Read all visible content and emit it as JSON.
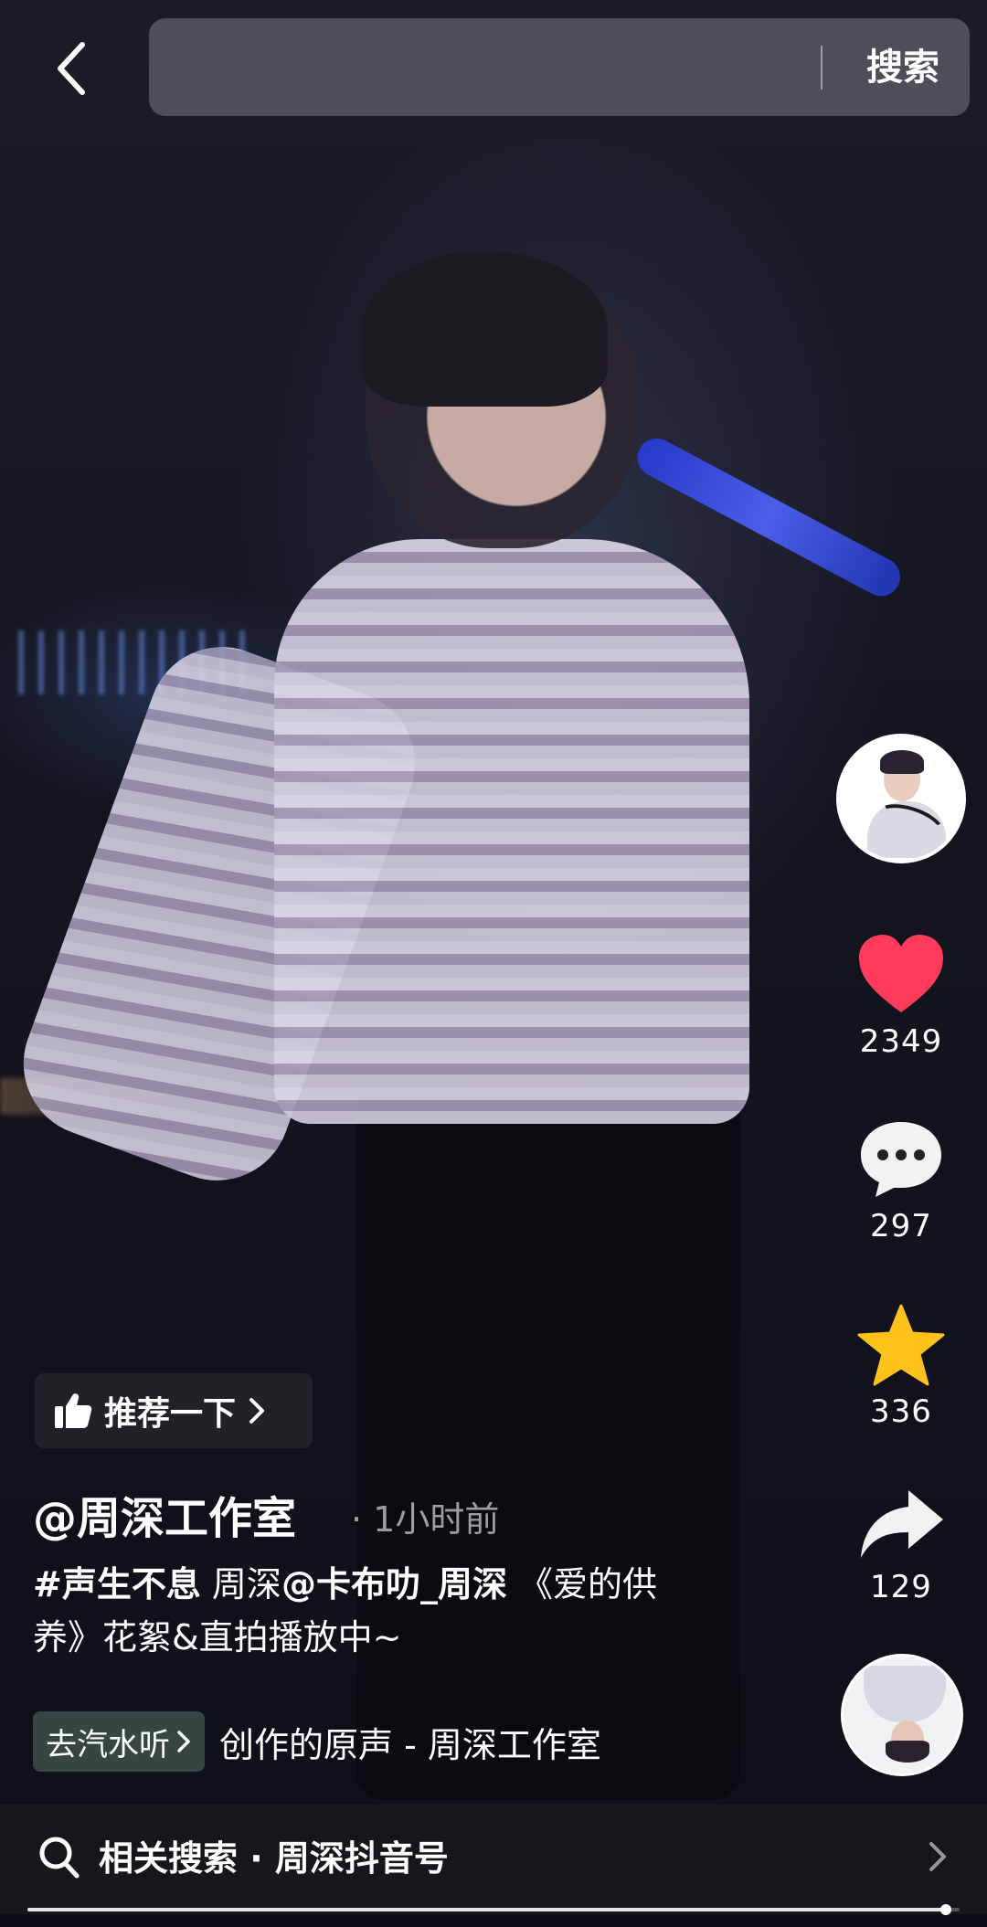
{
  "search": {
    "placeholder": "",
    "button_label": "搜索"
  },
  "video": {
    "recommend_label": "推荐一下",
    "author": "@周深工作室",
    "post_time": "· 1小时前",
    "caption": {
      "hashtag": "#声生不息",
      "text1": " 周深",
      "mention": "@卡布叻_周深",
      "text2": " 《爱的供养》花絮&直拍播放中~"
    },
    "music": {
      "chip_label": "去汽水听",
      "title": "创作的原声 - 周深工作室"
    }
  },
  "actions": {
    "likes": "2349",
    "comments": "297",
    "favorites": "336",
    "shares": "129"
  },
  "related_search": {
    "label": "相关搜索 · 周深抖音号"
  },
  "playback": {
    "progress_fraction": 0.985
  },
  "colors": {
    "like": "#ff3b5c",
    "favorite": "#ffc21a"
  }
}
